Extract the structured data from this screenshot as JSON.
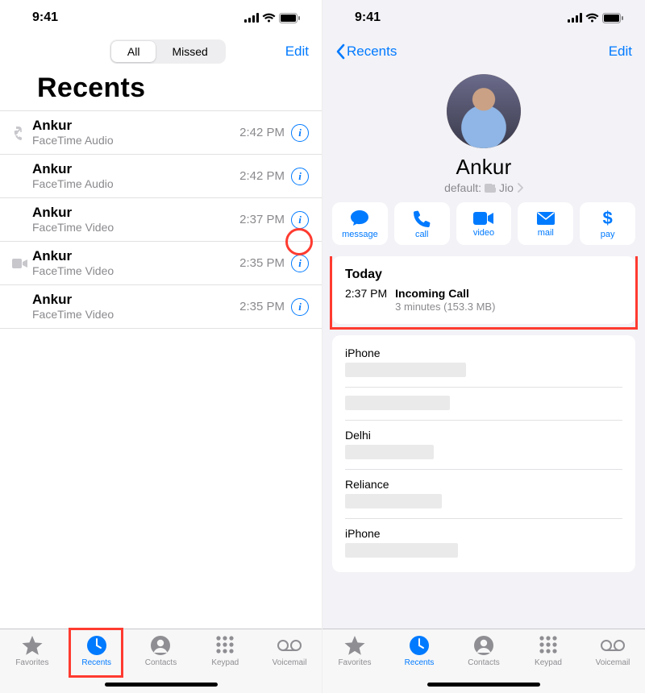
{
  "status": {
    "time": "9:41"
  },
  "left": {
    "segments": {
      "all": "All",
      "missed": "Missed"
    },
    "edit": "Edit",
    "title": "Recents",
    "calls": [
      {
        "name": "Ankur",
        "sub": "FaceTime Audio",
        "time": "2:42 PM",
        "lead": "out"
      },
      {
        "name": "Ankur",
        "sub": "FaceTime Audio",
        "time": "2:42 PM",
        "lead": ""
      },
      {
        "name": "Ankur",
        "sub": "FaceTime Video",
        "time": "2:37 PM",
        "lead": ""
      },
      {
        "name": "Ankur",
        "sub": "FaceTime Video",
        "time": "2:35 PM",
        "lead": "video"
      },
      {
        "name": "Ankur",
        "sub": "FaceTime Video",
        "time": "2:35 PM",
        "lead": ""
      }
    ]
  },
  "right": {
    "back": "Recents",
    "edit": "Edit",
    "contact": {
      "name": "Ankur",
      "default_label": "default:",
      "default_carrier": "Jio"
    },
    "actions": {
      "message": "message",
      "call": "call",
      "video": "video",
      "mail": "mail",
      "pay": "pay"
    },
    "log": {
      "header": "Today",
      "time": "2:37 PM",
      "type": "Incoming Call",
      "meta": "3 minutes (153.3 MB)"
    },
    "fields": [
      {
        "label": "iPhone"
      },
      {
        "label": ""
      },
      {
        "label": "Delhi"
      },
      {
        "label": "Reliance"
      },
      {
        "label": "iPhone"
      }
    ]
  },
  "tabs": {
    "favorites": "Favorites",
    "recents": "Recents",
    "contacts": "Contacts",
    "keypad": "Keypad",
    "voicemail": "Voicemail"
  }
}
